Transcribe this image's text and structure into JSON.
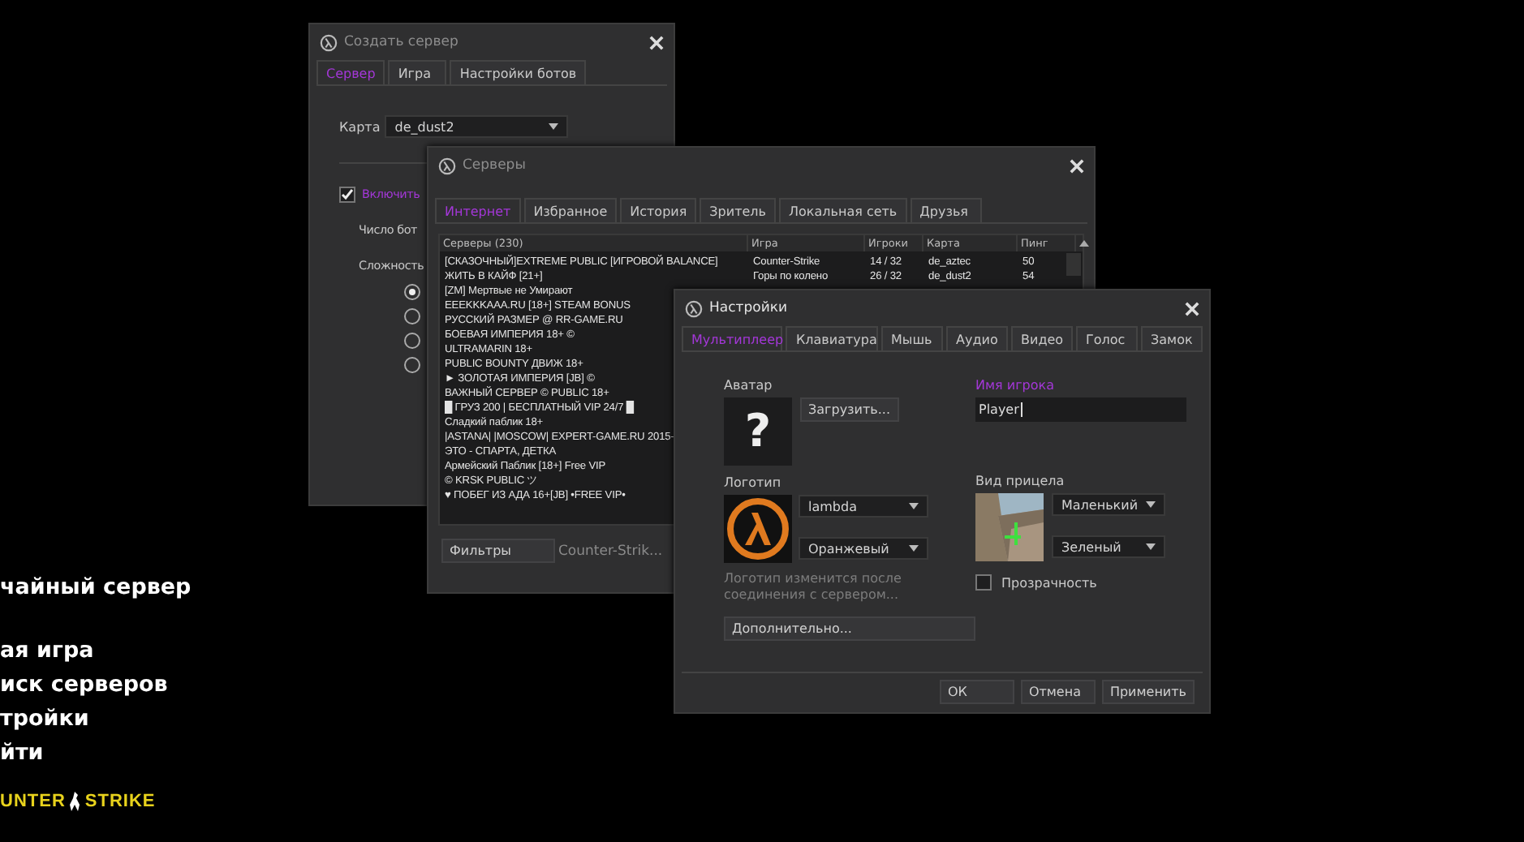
{
  "menu": {
    "groups": [
      [
        "чайный сервер"
      ],
      [
        "ая игра",
        "иск серверов",
        "тройки",
        "йти"
      ]
    ],
    "logo": [
      "UNTER",
      "STRIKE"
    ]
  },
  "create_server": {
    "title": "Создать сервер",
    "tabs": [
      {
        "label": "Сервер",
        "selected": true
      },
      {
        "label": "Игра",
        "selected": false
      },
      {
        "label": "Настройки ботов",
        "selected": false
      }
    ],
    "map": {
      "label": "Карта",
      "value": "de_dust2"
    },
    "bots": {
      "label": "Включить",
      "checked": true
    },
    "bot_count_label": "Число бот",
    "difficulty_label": "Сложность",
    "difficulty_options": [
      {
        "selected": true
      },
      {
        "selected": false
      },
      {
        "selected": false
      },
      {
        "selected": false
      }
    ]
  },
  "servers": {
    "title": "Серверы",
    "tabs": [
      {
        "label": "Интернет",
        "selected": true
      },
      {
        "label": "Избранное",
        "selected": false
      },
      {
        "label": "История",
        "selected": false
      },
      {
        "label": "Зритель",
        "selected": false
      },
      {
        "label": "Локальная сеть",
        "selected": false
      },
      {
        "label": "Друзья",
        "selected": false
      }
    ],
    "columns": [
      "Серверы (230)",
      "Игра",
      "Игроки",
      "Карта",
      "Пинг"
    ],
    "rows": [
      {
        "name": "[СКАЗОЧНЫЙ]EXTREME PUBLIC [ИГРОВОЙ BALANCE]",
        "game": "Counter-Strike",
        "players": "14 / 32",
        "map": "de_aztec",
        "ping": "50"
      },
      {
        "name": "ЖИТЬ В КАЙФ [21+]",
        "game": "Горы по колено",
        "players": "26 / 32",
        "map": "de_dust2",
        "ping": "54"
      },
      {
        "name": "[ZM] Мертвые не Умирают"
      },
      {
        "name": "EEEKKKAAA.RU [18+] STEAM BONUS"
      },
      {
        "name": "РУССКИЙ РАЗМЕР @ RR-GAME.RU"
      },
      {
        "name": "БОЕВАЯ ИМПЕРИЯ 18+ ©"
      },
      {
        "name": "ULTRAMARIN 18+"
      },
      {
        "name": "PUBLIC BOUNTY ДВИЖ 18+"
      },
      {
        "name": "► ЗОЛОТАЯ ИМПЕРИЯ [JB] ©"
      },
      {
        "name": "ВАЖНЫЙ СЕРВЕР © PUBLIC 18+"
      },
      {
        "name": "█ ГРУЗ 200 | БЕСПЛАТНЫЙ VIP 24/7 █"
      },
      {
        "name": "Сладкий паблик 18+"
      },
      {
        "name": "|ASTANA| |MOSCOW| EXPERT-GAME.RU 2015-"
      },
      {
        "name": "ЭТО - СПАРТА, ДЕТКА"
      },
      {
        "name": "Армейский Паблик [18+] Free VIP"
      },
      {
        "name": "© KRSK PUBLIC ツ"
      },
      {
        "name": "♥ ПОБЕГ ИЗ АДА 16+[JB] •FREE VIP•"
      }
    ],
    "filters_button": "Фильтры",
    "game_filter": "Counter-Strik..."
  },
  "settings": {
    "title": "Настройки",
    "tabs": [
      {
        "label": "Мультиплеер",
        "selected": true
      },
      {
        "label": "Клавиатура",
        "selected": false
      },
      {
        "label": "Мышь",
        "selected": false
      },
      {
        "label": "Аудио",
        "selected": false
      },
      {
        "label": "Видео",
        "selected": false
      },
      {
        "label": "Голос",
        "selected": false
      },
      {
        "label": "Замок",
        "selected": false
      }
    ],
    "avatar_label": "Аватар",
    "avatar_placeholder": "?",
    "upload_button": "Загрузить...",
    "player_name_label": "Имя игрока",
    "player_name_value": "Player",
    "logo_label": "Логотип",
    "logo_image": "lambda",
    "logo_color": "Оранжевый",
    "logo_note": "Логотип изменится после соединения с сервером...",
    "advanced_button": "Дополнительно...",
    "crosshair_label": "Вид прицела",
    "crosshair_size": "Маленький",
    "crosshair_color": "Зеленый",
    "transparency": {
      "label": "Прозрачность",
      "checked": false
    },
    "buttons": [
      "ОК",
      "Отмена",
      "Применить"
    ]
  }
}
